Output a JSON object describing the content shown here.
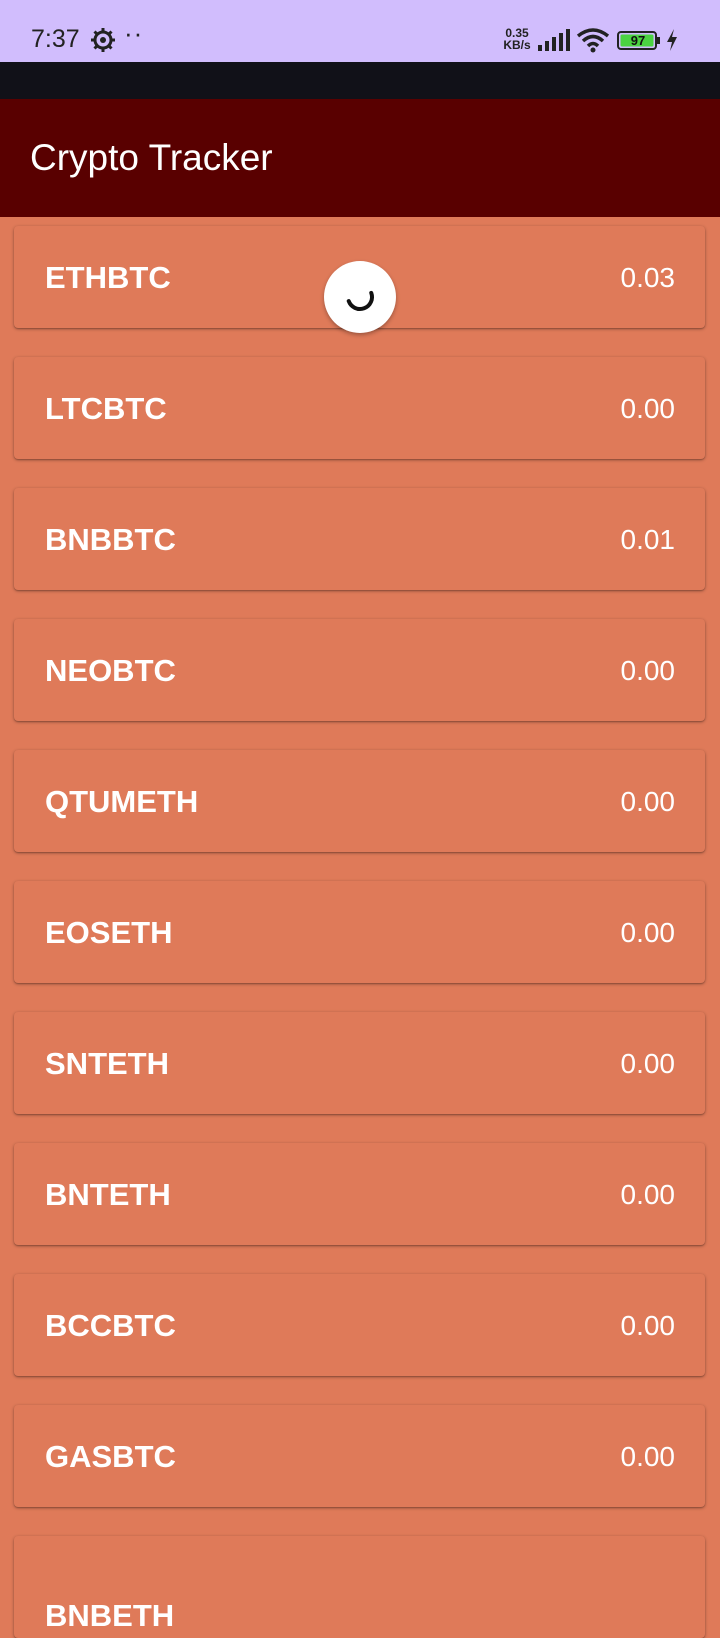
{
  "status_bar": {
    "time": "7:37",
    "speed_value": "0.35",
    "speed_unit": "KB/s",
    "battery": "97",
    "icons": [
      "gear-icon",
      "signal-icon",
      "wifi-icon",
      "battery-icon",
      "charging-bolt-icon"
    ]
  },
  "app_bar": {
    "title": "Crypto Tracker",
    "background": "#590000"
  },
  "list": {
    "background": "#df7a59",
    "items": [
      {
        "symbol": "ETHBTC",
        "price": "0.03"
      },
      {
        "symbol": "LTCBTC",
        "price": "0.00"
      },
      {
        "symbol": "BNBBTC",
        "price": "0.01"
      },
      {
        "symbol": "NEOBTC",
        "price": "0.00"
      },
      {
        "symbol": "QTUMETH",
        "price": "0.00"
      },
      {
        "symbol": "EOSETH",
        "price": "0.00"
      },
      {
        "symbol": "SNTETH",
        "price": "0.00"
      },
      {
        "symbol": "BNTETH",
        "price": "0.00"
      },
      {
        "symbol": "BCCBTC",
        "price": "0.00"
      },
      {
        "symbol": "GASBTC",
        "price": "0.00"
      },
      {
        "symbol": "BNBETH",
        "price": ""
      }
    ]
  }
}
